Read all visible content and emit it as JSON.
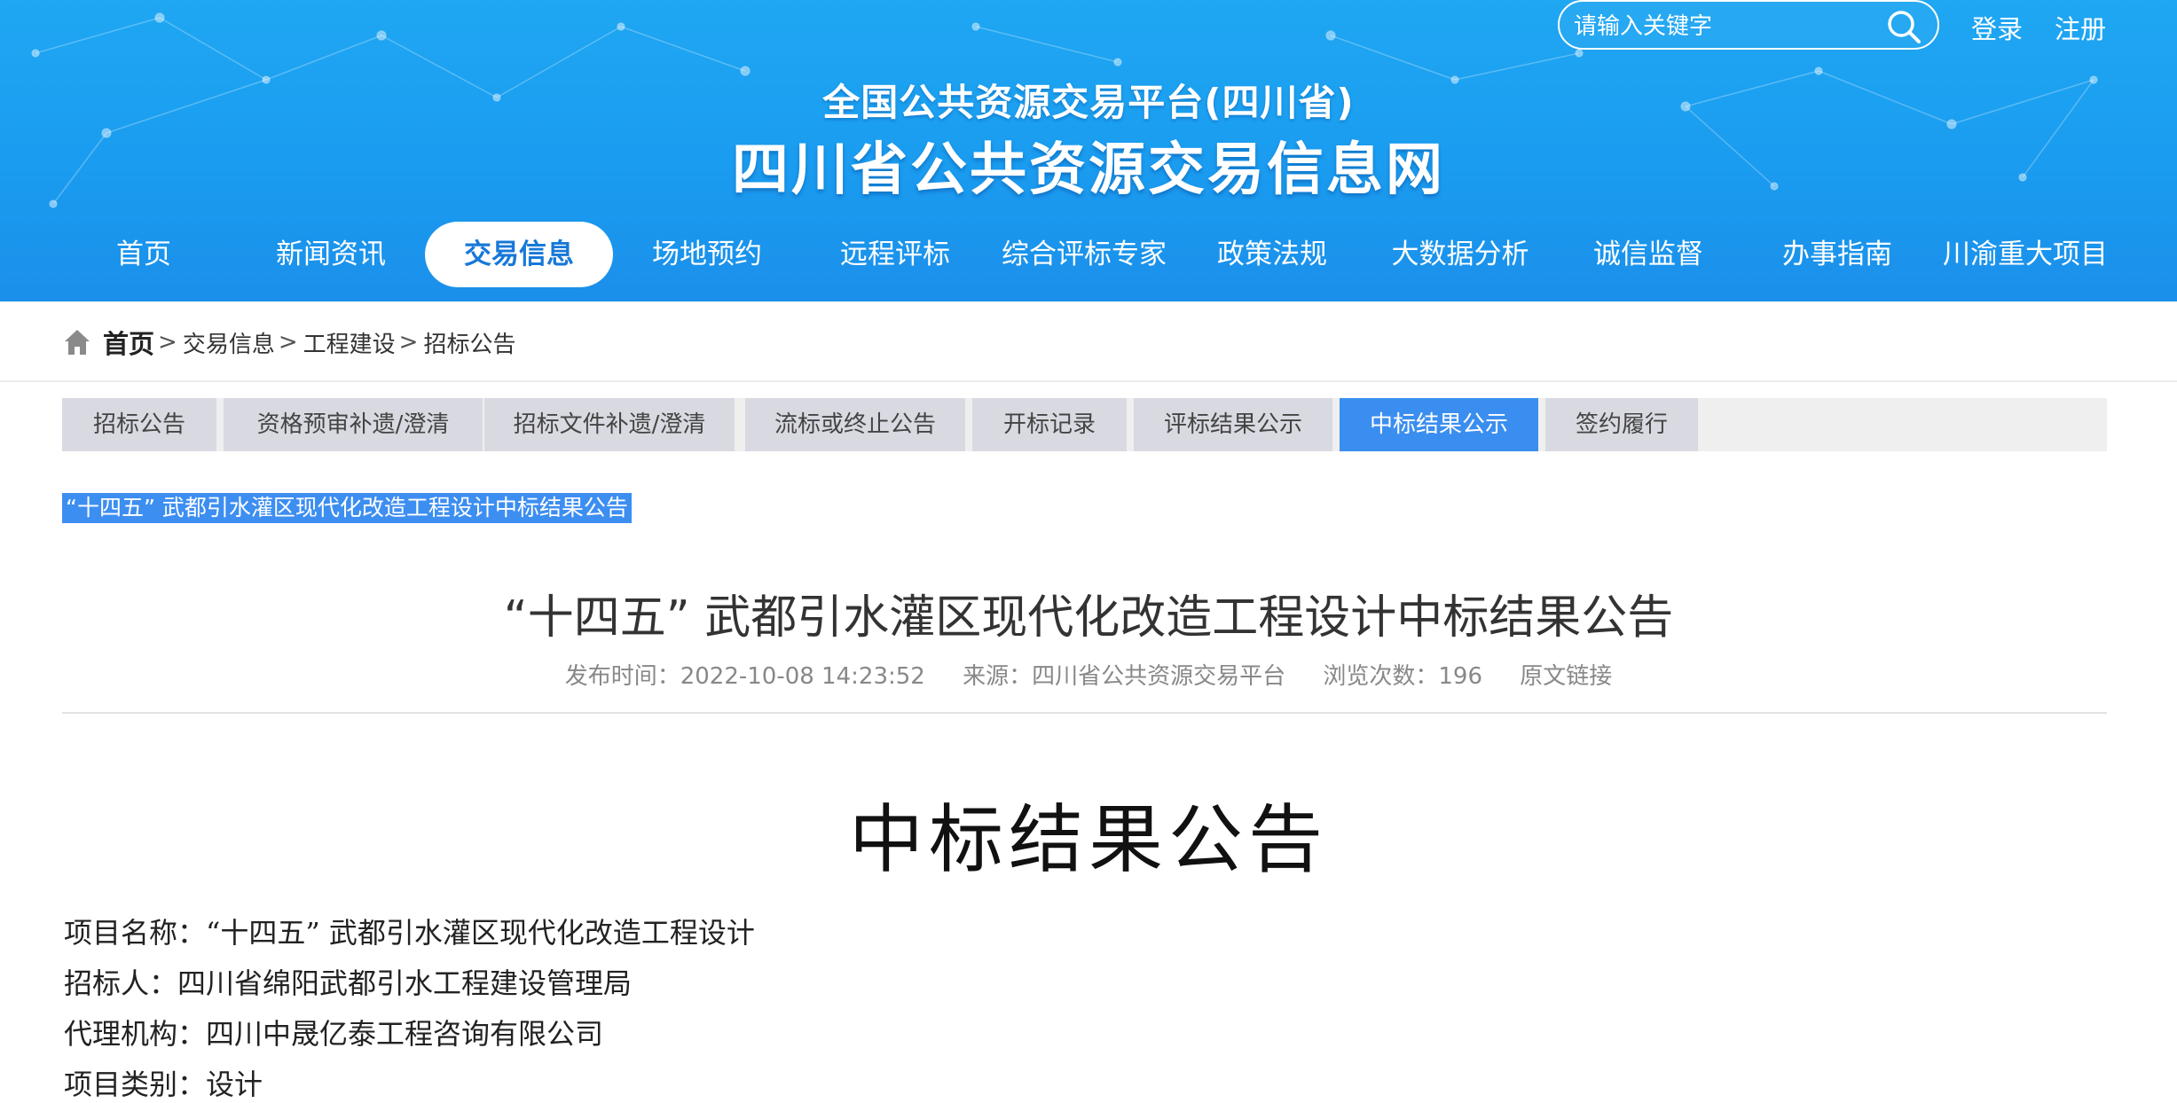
{
  "header": {
    "search_placeholder": "请输入关键字",
    "login": "登录",
    "register": "注册",
    "subtitle": "全国公共资源交易平台(四川省)",
    "title": "四川省公共资源交易信息网",
    "colors": {
      "banner": "#1fa7f2",
      "nav_active_text": "#1778d8"
    }
  },
  "nav": [
    {
      "label": "首页"
    },
    {
      "label": "新闻资讯"
    },
    {
      "label": "交易信息",
      "active": true
    },
    {
      "label": "场地预约"
    },
    {
      "label": "远程评标"
    },
    {
      "label": "综合评标专家库"
    },
    {
      "label": "政策法规"
    },
    {
      "label": "大数据分析"
    },
    {
      "label": "诚信监督"
    },
    {
      "label": "办事指南"
    },
    {
      "label": "川渝重大项目"
    }
  ],
  "breadcrumb": {
    "home": "首页",
    "items": [
      "交易信息",
      "工程建设",
      "招标公告"
    ],
    "separator": ">"
  },
  "tabs": [
    {
      "label": "招标公告"
    },
    {
      "label": "资格预审补遗/澄清"
    },
    {
      "label": "招标文件补遗/澄清"
    },
    {
      "label": "流标或终止公告"
    },
    {
      "label": "开标记录"
    },
    {
      "label": "评标结果公示"
    },
    {
      "label": "中标结果公示",
      "active": true
    },
    {
      "label": "签约履行"
    }
  ],
  "article": {
    "selected_title": "“十四五” 武都引水灌区现代化改造工程设计中标结果公告",
    "title": "“十四五” 武都引水灌区现代化改造工程设计中标结果公告",
    "meta": {
      "publish": "发布时间：2022-10-08 14:23:52",
      "source": "来源：四川省公共资源交易平台",
      "views": "浏览次数：196",
      "original_link": "原文链接"
    },
    "doc_heading": "中标结果公告",
    "info": [
      "项目名称：“十四五” 武都引水灌区现代化改造工程设计",
      "招标人：四川省绵阳武都引水工程建设管理局",
      "代理机构：四川中晟亿泰工程咨询有限公司",
      "项目类别：设计"
    ]
  }
}
